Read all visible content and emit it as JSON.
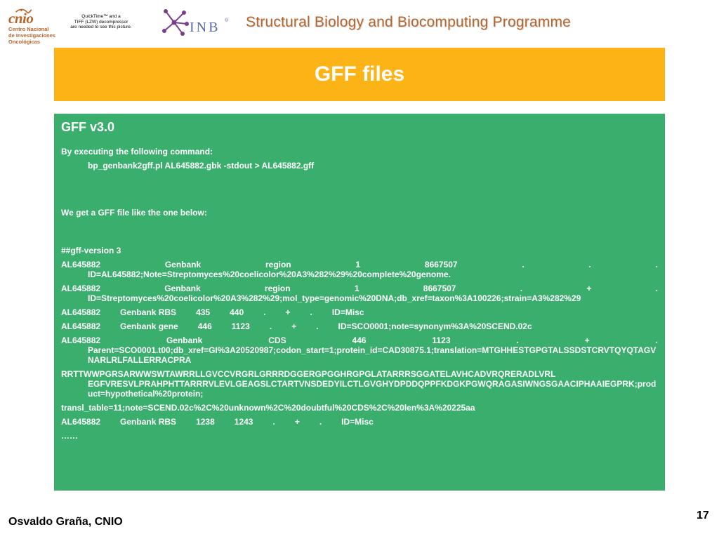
{
  "logos": {
    "cnio": {
      "word": "cnio",
      "lines": [
        "Centro Nacional",
        "de Investigaciones",
        "Oncológicas"
      ]
    },
    "quicktime_notice": [
      "QuickTime™ and a",
      "TIFF (LZW) decompressor",
      "are needed to see this picture."
    ],
    "inb": {
      "word": "INB",
      "reg": "®"
    }
  },
  "header": {
    "title": "Structural Biology and Biocomputing Programme"
  },
  "slide": {
    "title": "GFF files",
    "heading": "GFF v3.0",
    "intro": "By executing the following command:",
    "command": "bp_genbank2gff.pl AL645882.gbk -stdout > AL645882.gff",
    "description": "We get a GFF file like the one below:",
    "gff": {
      "version_line": "##gff-version 3",
      "r1": {
        "cols": [
          "AL645882",
          "Genbank",
          "region",
          "1",
          "8667507",
          ".",
          ".",
          "."
        ],
        "cont": "ID=AL645882;Note=Streptomyces%20coelicolor%20A3%282%29%20complete%20genome."
      },
      "r2": {
        "cols": [
          "AL645882",
          "Genbank",
          "region",
          "1",
          "8667507",
          ".",
          "+",
          "."
        ],
        "cont": "ID=Streptomyces%20coelicolor%20A3%282%29;mol_type=genomic%20DNA;db_xref=taxon%3A100226;strain=A3%282%29"
      },
      "r3": [
        "AL645882",
        "Genbank RBS",
        "435",
        "440",
        ".",
        "+",
        ".",
        "ID=Misc"
      ],
      "r4": [
        "AL645882",
        "Genbank gene",
        "446",
        "1123",
        ".",
        "+",
        ".",
        "ID=SCO0001;note=synonym%3A%20SCEND.02c"
      ],
      "r5": {
        "cols": [
          "AL645882",
          "Genbank",
          "CDS",
          "446",
          "1123",
          ".",
          "+",
          "."
        ],
        "cont": "Parent=SCO0001.t00;db_xref=GI%3A20520987;codon_start=1;protein_id=CAD30875.1;translation=MTGHHESTGPGTALSSDSTCRVTQYQTAGVNARLRLFALLERRACPRA"
      },
      "r6": {
        "first": "RRTTWWPGRSARWWSWTAWRRLLGVCCVRGRLGRRRDGGERGPGGHRGPGLATARRRSGGATELAVHCADVRQRERADLVRL",
        "cont": "EGFVRESVLPRAHPHTTARRRVLEVLGEAGSLCTARTVNSDEDYILCTLGVGHYDPDDQPPFKDGKPGWQRAGASIWNGSGAACIPHAAIEGPRK;product=hypothetical%20protein;"
      },
      "r7": "transl_table=11;note=SCEND.02c%2C%20unknown%2C%20doubtful%20CDS%2C%20len%3A%20225aa",
      "r8": [
        "AL645882",
        "Genbank RBS",
        "1238",
        "1243",
        ".",
        "+",
        ".",
        "ID=Misc"
      ],
      "ellipsis": "……"
    }
  },
  "footer": {
    "author": "Osvaldo Graña, CNIO",
    "page": "17"
  }
}
